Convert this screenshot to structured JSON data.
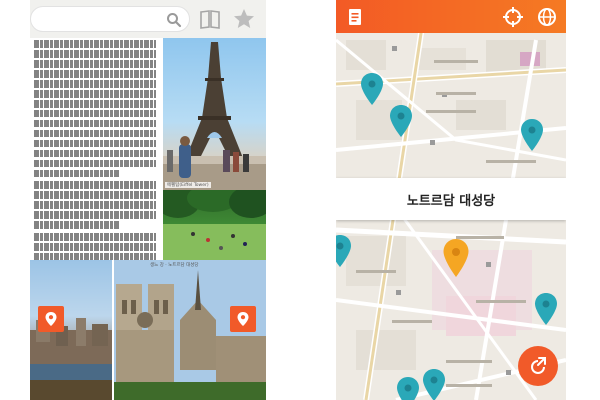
{
  "left_screen": {
    "search": {
      "placeholder": ""
    },
    "photo_captions": {
      "eiffel": "에펠탑(Eiffel Tower)",
      "notre_dame": "생느 강 · 노트르담 대성당"
    },
    "icons": [
      "search-icon",
      "book-icon",
      "star-icon",
      "map-pin-icon"
    ]
  },
  "right_screen": {
    "poi_title": "노트르담 대성당",
    "colors": {
      "accent": "#f15a29",
      "marker_teal": "#2aa8b8",
      "marker_selected": "#f5a623",
      "map_bg": "#eeeae3"
    },
    "icons": [
      "document-icon",
      "crosshair-icon",
      "globe-icon",
      "share-icon",
      "map-marker-icon"
    ]
  }
}
